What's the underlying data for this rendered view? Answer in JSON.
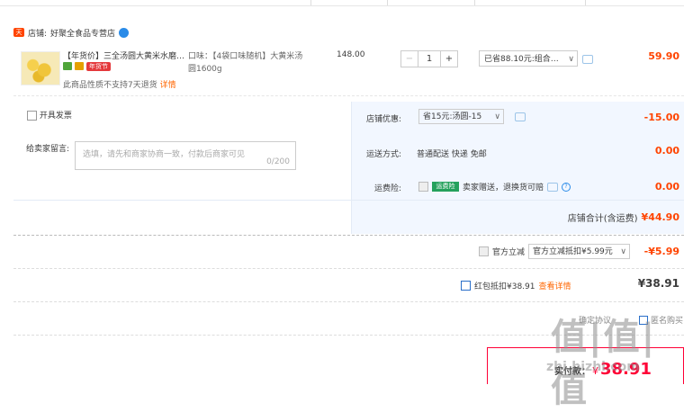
{
  "colors": {
    "accent_red": "#ff4400",
    "price_red": "#ff0036",
    "link_orange": "#ff6600",
    "pane_bg": "#f2f7ff",
    "insurance_green": "#25a15c"
  },
  "shop": {
    "prefix": "店铺:",
    "name": "好聚全食品专营店"
  },
  "item": {
    "title": "【年货价】三全汤圆大黄米水磨…",
    "badge": "年货节",
    "return_note": "此商品性质不支持7天退货",
    "return_link": "详情",
    "sku_line1": "口味：【4袋口味随机】大黄米汤",
    "sku_line2": "圆1600g",
    "unit_price": "148.00",
    "quantity": "1",
    "minus": "−",
    "plus": "+",
    "promo": "已省88.10元:组合…",
    "subtotal": "59.90"
  },
  "invoice": {
    "label": "开具发票"
  },
  "message": {
    "label": "给卖家留言:",
    "placeholder": "选填，请先和商家协商一致，付款后商家可见",
    "count": "0/200"
  },
  "shop_discount": {
    "label": "店铺优惠:",
    "value": "省15元:汤圆-15",
    "amount": "-15.00"
  },
  "shipping": {
    "label": "运送方式:",
    "value": "普通配送 快递 免邮",
    "amount": "0.00"
  },
  "insurance": {
    "label": "运费险:",
    "tag": "运费险",
    "text": "卖家赠送，退换货可赔",
    "help": "?",
    "amount": "0.00"
  },
  "shop_total": {
    "label": "店铺合计(含运费)",
    "amount": "¥44.90"
  },
  "official": {
    "label": "官方立减",
    "value": "官方立减抵扣¥5.99元",
    "amount": "-¥5.99"
  },
  "redpacket": {
    "label": "红包抵扣¥38.91",
    "link": "查看详情",
    "amount": "¥38.91"
  },
  "footer_partial": {
    "left": "确定协议",
    "right": "匿名购买"
  },
  "pay": {
    "label": "实付款：",
    "currency": "¥",
    "amount": "38.91"
  },
  "watermark": {
    "big": "值|值|值",
    "small": "zhi.bizhi.com"
  }
}
